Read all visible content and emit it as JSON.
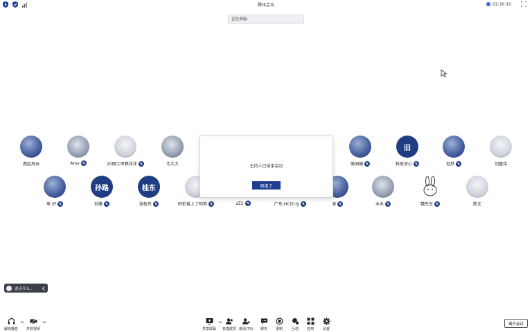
{
  "titlebar": {
    "title": "腾讯会议",
    "timer": "02:20:10"
  },
  "speaking_banner": "正在讲话:",
  "participants": [
    {
      "name": "燕赵风云",
      "avatar": "photo-blue",
      "muted": false
    },
    {
      "name": "Amy",
      "avatar": "photo-gray",
      "muted": true
    },
    {
      "name": "20网工甲赖洋洋",
      "avatar": "photo-light",
      "muted": true
    },
    {
      "name": "韦大大",
      "avatar": "photo-gray",
      "muted": false
    },
    {
      "name": "美国捕",
      "avatar": "photo-blue",
      "muted": true
    },
    {
      "name": "秋夜凉心",
      "avatar": "text",
      "avatar_text": "旧",
      "muted": true
    },
    {
      "name": "坦然",
      "avatar": "photo-blue",
      "muted": true
    },
    {
      "name": "刘嘉伟",
      "avatar": "photo-light",
      "muted": false
    },
    {
      "name": "早.好",
      "avatar": "photo-blue",
      "muted": true
    },
    {
      "name": "孙路",
      "avatar": "text",
      "avatar_text": "孙路",
      "muted": true
    },
    {
      "name": "张桂东",
      "avatar": "text",
      "avatar_text": "桂东",
      "muted": true
    },
    {
      "name": "阿彩爱上了阿狗",
      "avatar": "photo-light",
      "muted": true
    },
    {
      "name": "zZ2",
      "avatar": "photo-gray",
      "muted": true
    },
    {
      "name": "广东-HCIE-ty",
      "avatar": "photo-gray",
      "muted": true
    },
    {
      "name": "涛",
      "avatar": "photo-blue",
      "muted": true
    },
    {
      "name": "木木",
      "avatar": "photo-gray",
      "muted": true
    },
    {
      "name": "魏先生",
      "avatar": "bunny",
      "muted": true
    },
    {
      "name": "陈文",
      "avatar": "photo-light",
      "muted": false
    }
  ],
  "dialog": {
    "message": "主持人已结束会议",
    "button": "知道了"
  },
  "chat_pill": "说点什么...",
  "toolbar": {
    "mute": "解除静音",
    "video": "开启视频",
    "share": "共享屏幕",
    "members": "管理成员",
    "invite": "邀请(79)",
    "chat": "聊天",
    "record": "录制",
    "reactions": "互动",
    "apps": "应用",
    "settings": "设置",
    "leave": "离开会议"
  },
  "colors": {
    "accent": "#1e3f8f",
    "dialog_button": "#1e3f8f",
    "chat_pill": "#3a3f4a"
  }
}
